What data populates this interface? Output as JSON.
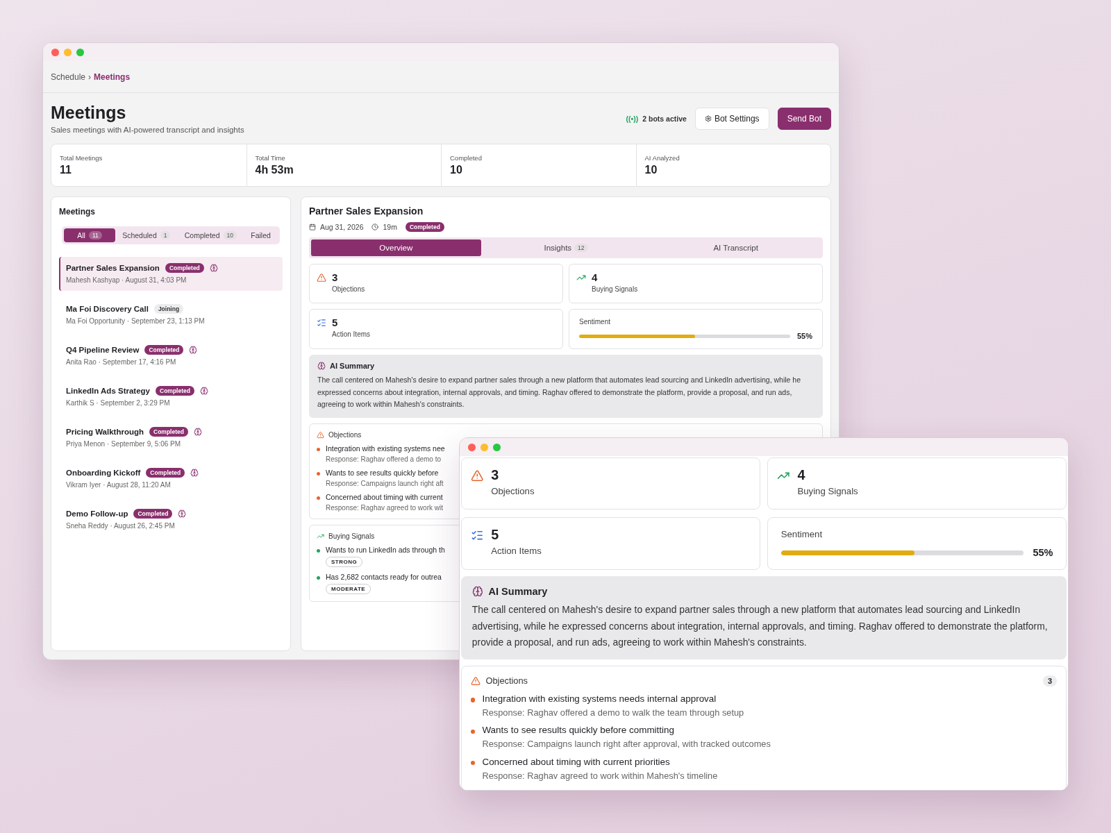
{
  "back_window": {
    "breadcrumb": {
      "items": [
        "Schedule",
        "Meetings"
      ],
      "separator": "›"
    },
    "page": {
      "title": "Meetings",
      "subtitle": "Sales meetings with AI-powered transcript and insights"
    },
    "bot_status": {
      "signal": "((•))",
      "label": "2 bots active"
    },
    "buttons": [
      {
        "label": "Bot Settings",
        "kind": "secondary"
      },
      {
        "label": "Send Bot",
        "kind": "primary"
      }
    ],
    "stats": [
      {
        "label": "Total Meetings",
        "value": "11"
      },
      {
        "label": "Total Time",
        "value": "4h 53m"
      },
      {
        "label": "Completed",
        "value": "10"
      },
      {
        "label": "AI Analyzed",
        "value": "10"
      }
    ],
    "meetings_panel": {
      "title": "Meetings",
      "filters": [
        {
          "label": "All",
          "count": "11",
          "selected": true
        },
        {
          "label": "Scheduled",
          "count": "1",
          "selected": false
        },
        {
          "label": "Completed",
          "count": "10",
          "selected": false
        },
        {
          "label": "Failed",
          "selected": false
        }
      ],
      "items": [
        {
          "title": "Partner Sales Expansion",
          "status": {
            "label": "Completed",
            "kind": "completed"
          },
          "ai": true,
          "subtitle": "Mahesh Kashyap · August 31, 4:03 PM",
          "selected": true
        },
        {
          "title": "Ma Foi Discovery Call",
          "status": {
            "label": "Joining",
            "kind": "joining"
          },
          "ai": false,
          "subtitle": "Ma Foi Opportunity · September 23, 1:13 PM",
          "selected": false
        },
        {
          "title": "Q4 Pipeline Review",
          "status": {
            "label": "Completed",
            "kind": "completed"
          },
          "ai": true,
          "subtitle": "Anita Rao · September 17, 4:16 PM",
          "selected": false
        },
        {
          "title": "LinkedIn Ads Strategy",
          "status": {
            "label": "Completed",
            "kind": "completed"
          },
          "ai": true,
          "subtitle": "Karthik S · September 2, 3:29 PM",
          "selected": false
        },
        {
          "title": "Pricing Walkthrough",
          "status": {
            "label": "Completed",
            "kind": "completed"
          },
          "ai": true,
          "subtitle": "Priya Menon · September 9, 5:06 PM",
          "selected": false
        },
        {
          "title": "Onboarding Kickoff",
          "status": {
            "label": "Completed",
            "kind": "completed"
          },
          "ai": true,
          "subtitle": "Vikram Iyer · August 28, 11:20 AM",
          "selected": false
        },
        {
          "title": "Demo Follow-up",
          "status": {
            "label": "Completed",
            "kind": "completed"
          },
          "ai": true,
          "subtitle": "Sneha Reddy · August 26, 2:45 PM",
          "selected": false
        }
      ]
    },
    "detail": {
      "title": "Partner Sales Expansion",
      "date": "Aug 31, 2026",
      "duration": "19m",
      "status": {
        "label": "Completed",
        "kind": "completed"
      },
      "tabs": [
        {
          "label": "Overview",
          "selected": true
        },
        {
          "label": "Insights",
          "count": "12",
          "selected": false
        },
        {
          "label": "AI Transcript",
          "selected": false
        }
      ],
      "metrics": [
        {
          "kind": "objections",
          "value": "3",
          "label": "Objections"
        },
        {
          "kind": "signals",
          "value": "4",
          "label": "Buying Signals"
        },
        {
          "kind": "actions",
          "value": "5",
          "label": "Action Items"
        }
      ],
      "sentiment": {
        "label": "Sentiment",
        "level": 0.55,
        "reading": "55%"
      },
      "summary": {
        "title": "AI Summary",
        "text": "The call centered on Mahesh's desire to expand partner sales through a new platform that automates lead sourcing and LinkedIn advertising, while he expressed concerns about integration, internal approvals, and timing. Raghav offered to demonstrate the platform, provide a proposal, and run ads, agreeing to work within Mahesh's constraints."
      },
      "objections": {
        "title": "Objections",
        "items": [
          {
            "text": "Integration with existing systems nee",
            "response": "Response: Raghav offered a demo to"
          },
          {
            "text": "Wants to see results quickly before",
            "response": "Response: Campaigns launch right aft"
          },
          {
            "text": "Concerned about timing with current",
            "response": "Response: Raghav agreed to work wit"
          }
        ]
      },
      "buying_signals": {
        "title": "Buying Signals",
        "items": [
          {
            "text": "Wants to run LinkedIn ads through th",
            "strength": "STRONG"
          },
          {
            "text": "Has 2,682 contacts ready for outrea",
            "strength": "MODERATE"
          }
        ]
      }
    }
  },
  "front_window": {
    "metrics": [
      {
        "kind": "objections",
        "value": "3",
        "label": "Objections"
      },
      {
        "kind": "signals",
        "value": "4",
        "label": "Buying Signals"
      },
      {
        "kind": "actions",
        "value": "5",
        "label": "Action Items"
      }
    ],
    "sentiment": {
      "label": "Sentiment",
      "level": 0.55,
      "reading": "55%"
    },
    "summary": {
      "title": "AI Summary",
      "text": "The call centered on Mahesh's desire to expand partner sales through a new platform that automates lead sourcing and LinkedIn advertising, while he expressed concerns about integration, internal approvals, and timing. Raghav offered to demonstrate the platform, provide a proposal, and run ads, agreeing to work within Mahesh's constraints."
    },
    "objections": {
      "title": "Objections",
      "count": "3",
      "items": [
        {
          "text": "Integration with existing systems needs internal approval",
          "response": "Response: Raghav offered a demo to walk the team through setup"
        },
        {
          "text": "Wants to see results quickly before committing",
          "response": "Response: Campaigns launch right after approval, with tracked outcomes"
        },
        {
          "text": "Concerned about timing with current priorities",
          "response": "Response: Raghav agreed to work within Mahesh's timeline"
        }
      ]
    }
  }
}
